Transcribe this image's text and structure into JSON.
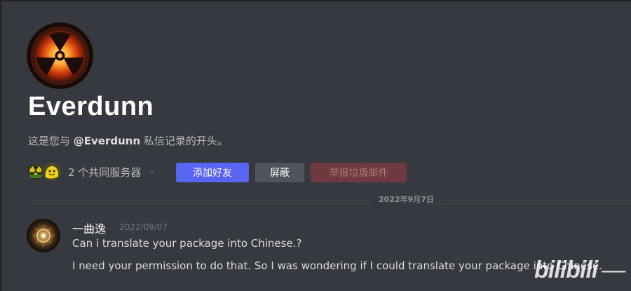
{
  "profile": {
    "username": "Everdunn",
    "intro_prefix": "这是您与 ",
    "intro_mention": "@Everdunn",
    "intro_suffix": " 私信记录的开头。",
    "mutual_servers": "2 个共同服务器",
    "avatar_icon": "radiation-fire-avatar",
    "server_icons": [
      "radiation-server-icon",
      "yellow-blob-server-icon"
    ]
  },
  "actions": {
    "add_friend": "添加好友",
    "block": "屏蔽",
    "report_spam": "举报垃圾邮件"
  },
  "date_divider": "2022年9月7日",
  "message": {
    "author": "一曲逸",
    "timestamp": "2022/09/07",
    "lines": [
      "Can i translate your package into Chinese.?",
      "I need your permission to do that. So I was wondering if I could translate your package into Chinese."
    ]
  },
  "watermark": {
    "text": "bilibili",
    "dash": "—"
  },
  "colors": {
    "background": "#36393f",
    "blurple": "#5865f2",
    "block_button": "#4f545c",
    "report_button": "#6e3a3f",
    "username": "#ffffff",
    "muted_text": "#b9bbbe"
  }
}
